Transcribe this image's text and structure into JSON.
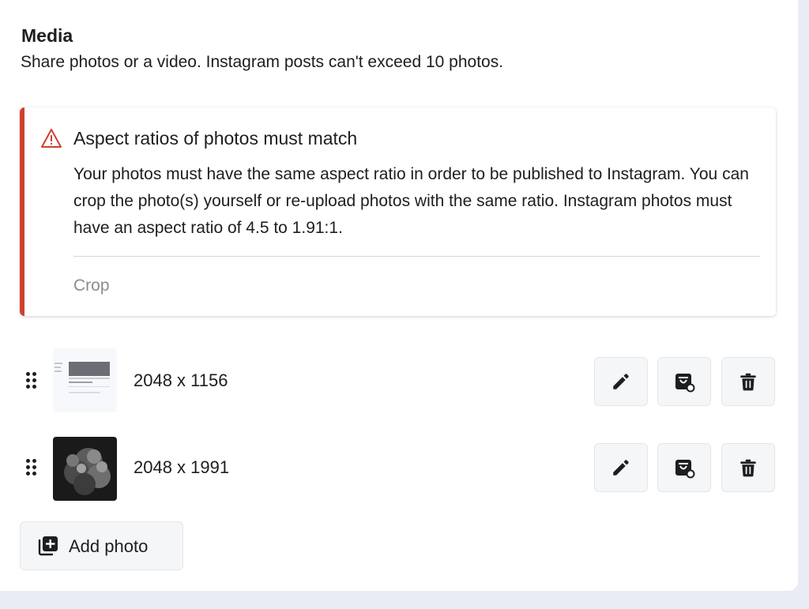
{
  "section": {
    "title": "Media",
    "subtitle": "Share photos or a video. Instagram posts can't exceed 10 photos."
  },
  "alert": {
    "icon": "warning-triangle-icon",
    "accent_color": "#d0402f",
    "title": "Aspect ratios of photos must match",
    "body": "Your photos must have the same aspect ratio in order to be published to Instagram. You can crop the photo(s) yourself or re-upload photos with the same ratio. Instagram photos must have an aspect ratio of 4.5 to 1.91:1.",
    "action_label": "Crop"
  },
  "photos": [
    {
      "dimensions": "2048 x 1156",
      "thumbnail": "screenshot-thumbnail"
    },
    {
      "dimensions": "2048 x 1991",
      "thumbnail": "smoke-photo-thumbnail"
    }
  ],
  "row_actions": {
    "edit_icon": "pencil-icon",
    "tag_icon": "product-tag-icon",
    "delete_icon": "trash-icon"
  },
  "add_photo": {
    "label": "Add photo",
    "icon": "add-photo-icon"
  }
}
